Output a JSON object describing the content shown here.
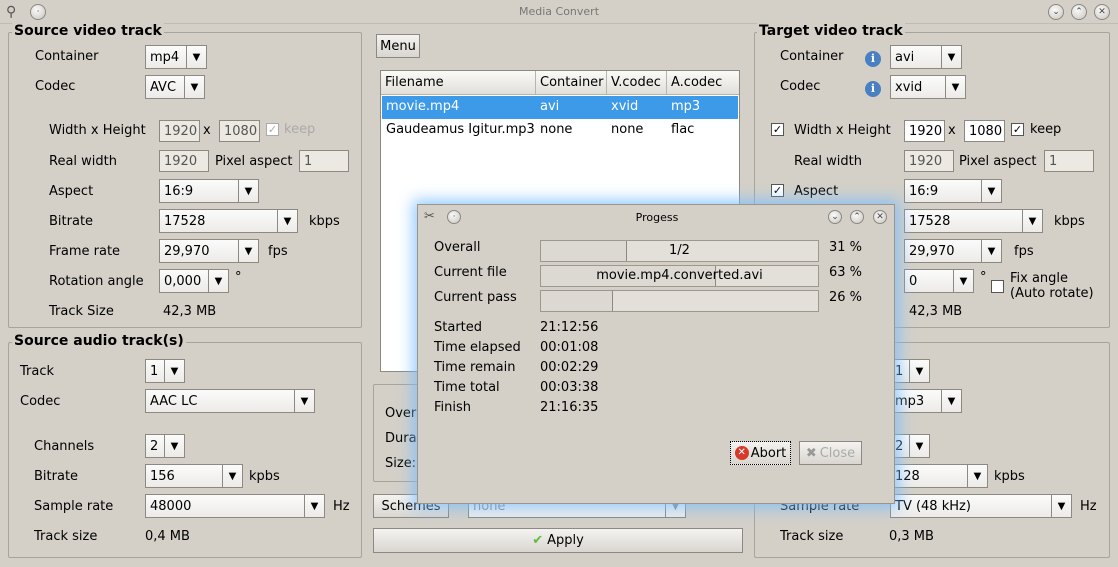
{
  "window": {
    "title": "Media Convert"
  },
  "source_video": {
    "title": "Source video track",
    "container_label": "Container",
    "container_value": "mp4",
    "codec_label": "Codec",
    "codec_value": "AVC",
    "wh_label": "Width x Height",
    "width": "1920",
    "x_sep": "x",
    "height": "1080",
    "keep_label": "keep",
    "real_width_label": "Real width",
    "real_width": "1920",
    "pixel_aspect_label": "Pixel aspect",
    "pixel_aspect": "1",
    "aspect_label": "Aspect",
    "aspect_value": "16:9",
    "bitrate_label": "Bitrate",
    "bitrate_value": "17528",
    "bitrate_unit": "kbps",
    "framerate_label": "Frame rate",
    "framerate_value": "29,970",
    "framerate_unit": "fps",
    "rotation_label": "Rotation angle",
    "rotation_value": "0,000",
    "rotation_unit": "°",
    "tracksize_label": "Track Size",
    "tracksize_value": "42,3 MB"
  },
  "source_audio": {
    "title": "Source audio track(s)",
    "track_label": "Track",
    "track_value": "1",
    "codec_label": "Codec",
    "codec_value": "AAC LC",
    "channels_label": "Channels",
    "channels_value": "2",
    "bitrate_label": "Bitrate",
    "bitrate_value": "156",
    "bitrate_unit": "kpbs",
    "samplerate_label": "Sample rate",
    "samplerate_value": "48000",
    "samplerate_unit": "Hz",
    "tracksize_label": "Track size",
    "tracksize_value": "0,4 MB"
  },
  "center": {
    "menu_label": "Menu",
    "table": {
      "headers": [
        "Filename",
        "Container",
        "V.codec",
        "A.codec"
      ],
      "rows": [
        [
          "movie.mp4",
          "avi",
          "xvid",
          "mp3"
        ],
        [
          "Gaudeamus Igitur.mp3",
          "none",
          "none",
          "flac"
        ]
      ]
    },
    "info_labels": [
      "Overa",
      "Dura",
      "Size:"
    ],
    "schemes_label": "Schemes",
    "schemes_value": "none",
    "apply_label": "Apply"
  },
  "target_video": {
    "title": "Target video track",
    "container_label": "Container",
    "container_value": "avi",
    "codec_label": "Codec",
    "codec_value": "xvid",
    "wh_label": "Width x Height",
    "width": "1920",
    "x_sep": "x",
    "height": "1080",
    "keep_label": "keep",
    "real_width_label": "Real width",
    "real_width": "1920",
    "pixel_aspect_label": "Pixel aspect",
    "pixel_aspect": "1",
    "aspect_label": "Aspect",
    "aspect_value": "16:9",
    "bitrate_value": "17528",
    "bitrate_unit": "kbps",
    "framerate_value": "29,970",
    "framerate_unit": "fps",
    "rotation_value": "0",
    "rotation_unit": "°",
    "fix_angle_line1": "Fix angle",
    "fix_angle_line2": "(Auto rotate)",
    "tracksize_value": "42,3 MB"
  },
  "target_audio": {
    "track_value": "1",
    "codec_value": "mp3",
    "channels_value": "2",
    "bitrate_value": "128",
    "bitrate_unit": "kpbs",
    "samplerate_label": "Sample rate",
    "samplerate_value": "TV (48 kHz)",
    "samplerate_unit": "Hz",
    "tracksize_label": "Track size",
    "tracksize_value": "0,3 MB"
  },
  "progress": {
    "title": "Progess",
    "overall_label": "Overall",
    "overall_text": "1/2",
    "overall_percent": "31 %",
    "overall_fraction": 0.31,
    "file_label": "Current file",
    "file_text": "movie.mp4.converted.avi",
    "file_percent": "63 %",
    "file_fraction": 0.63,
    "pass_label": "Current pass",
    "pass_text": "",
    "pass_percent": "26 %",
    "pass_fraction": 0.26,
    "started_label": "Started",
    "started_value": "21:12:56",
    "elapsed_label": "Time elapsed",
    "elapsed_value": "00:01:08",
    "remain_label": "Time remain",
    "remain_value": "00:02:29",
    "total_label": "Time total",
    "total_value": "00:03:38",
    "finish_label": "Finish",
    "finish_value": "21:16:35",
    "abort_label": "Abort",
    "close_label": "Close"
  },
  "colors": {
    "selection": "#3d9ae8",
    "dialog_glow": "#78beff",
    "abort_icon": "#d63a2a",
    "apply_icon": "#5bbf3a"
  }
}
